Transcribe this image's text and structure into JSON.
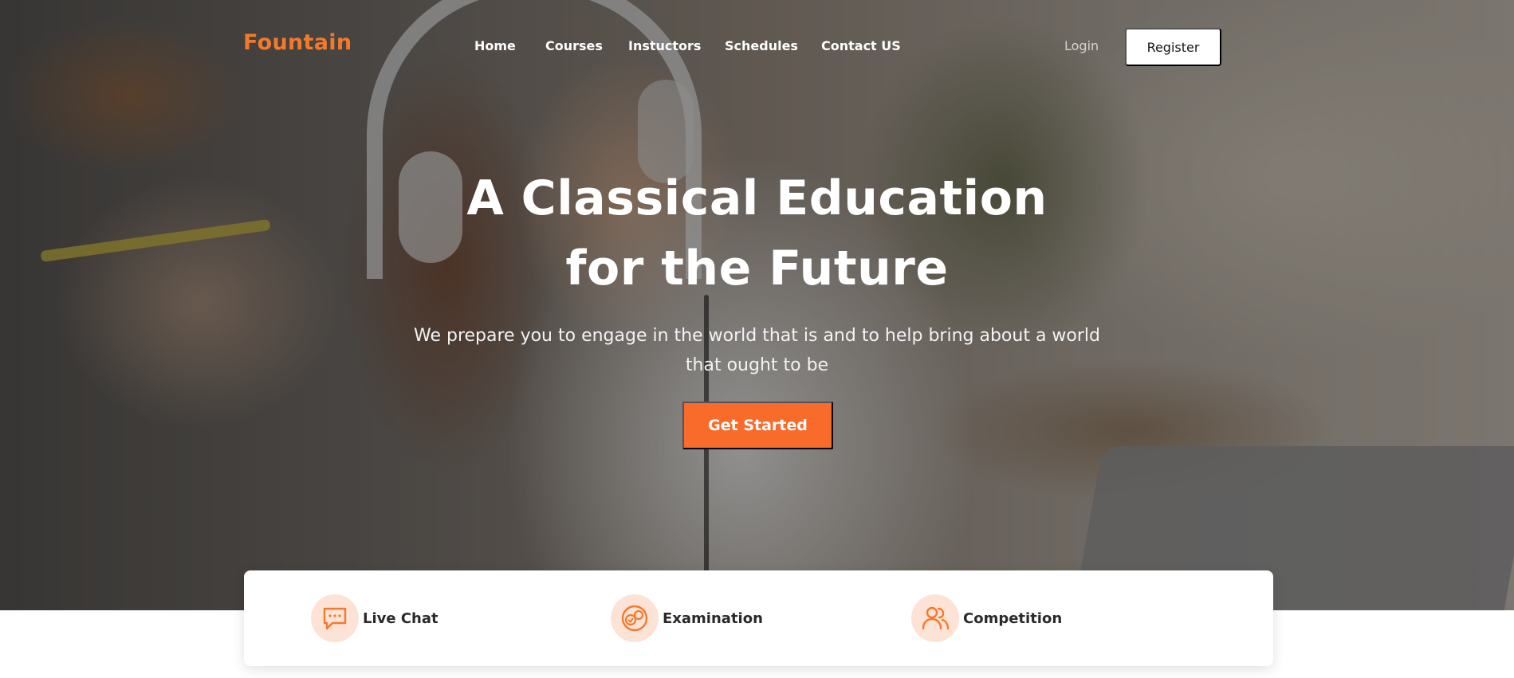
{
  "brand": {
    "name": "Fountain",
    "color": "#f37a2c"
  },
  "nav": {
    "items": [
      {
        "label": "Home"
      },
      {
        "label": "Courses"
      },
      {
        "label": "Instuctors"
      },
      {
        "label": "Schedules"
      },
      {
        "label": "Contact US"
      }
    ]
  },
  "auth": {
    "login_label": "Login",
    "register_label": "Register"
  },
  "hero": {
    "headline_line1": "A Classical Education",
    "headline_line2": "for the Future",
    "subtext_line1": "We prepare you to engage in the world that is and to help bring about a world",
    "subtext_line2": "that ought to be",
    "cta_label": "Get Started",
    "cta_color": "#f96b2b"
  },
  "features": [
    {
      "label": "Live Chat",
      "icon": "chat-bubble-icon"
    },
    {
      "label": "Examination",
      "icon": "examination-icon"
    },
    {
      "label": "Competition",
      "icon": "users-icon"
    }
  ]
}
